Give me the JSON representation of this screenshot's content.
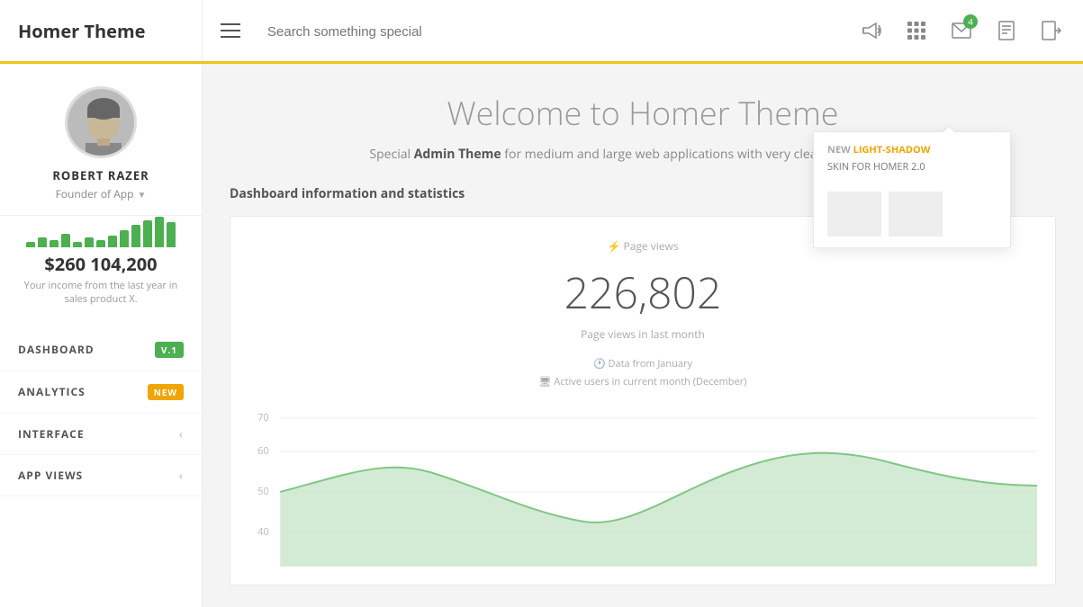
{
  "navbar": {
    "brand": "Homer Theme",
    "search_placeholder": "Search something special",
    "icons": {
      "megaphone": "📢",
      "apps": "⠿",
      "mail_badge": "4",
      "document": "📋",
      "logout": "⬚"
    }
  },
  "sidebar": {
    "profile": {
      "name": "ROBERT RAZER",
      "role": "Founder of App"
    },
    "income": {
      "value": "$260 104,200",
      "description": "Your income from the last year in sales product X."
    },
    "bars": [
      3,
      5,
      4,
      7,
      3,
      5,
      4,
      6,
      9,
      12,
      14,
      16,
      13
    ],
    "nav": [
      {
        "label": "DASHBOARD",
        "badge": "V.1",
        "badge_type": "green",
        "chevron": false
      },
      {
        "label": "ANALYTICS",
        "badge": "NEW",
        "badge_type": "orange",
        "chevron": false
      },
      {
        "label": "INTERFACE",
        "badge": "",
        "badge_type": "",
        "chevron": true
      },
      {
        "label": "APP VIEWS",
        "badge": "",
        "badge_type": "",
        "chevron": true
      }
    ]
  },
  "main": {
    "welcome_title": "Welcome to Homer Theme",
    "welcome_sub_prefix": "Special ",
    "welcome_sub_bold": "Admin Theme",
    "welcome_sub_suffix": " for medium and large web applications with very clean and aesthetic s",
    "section_title": "Dashboard information and statistics",
    "chart": {
      "label": "Page views",
      "number": "226,802",
      "number_sub": "Page views in last month",
      "info_line1": "Data from January",
      "info_line2": "Active users in current month (December)",
      "y_labels": [
        "70",
        "60",
        "50",
        "40"
      ],
      "chart_color": "#c8e6c9"
    }
  },
  "notification_popup": {
    "new_label": "NEW",
    "highlight": "LIGHT-SHADOW",
    "skin_label": "SKIN FOR HOMER 2.0"
  }
}
